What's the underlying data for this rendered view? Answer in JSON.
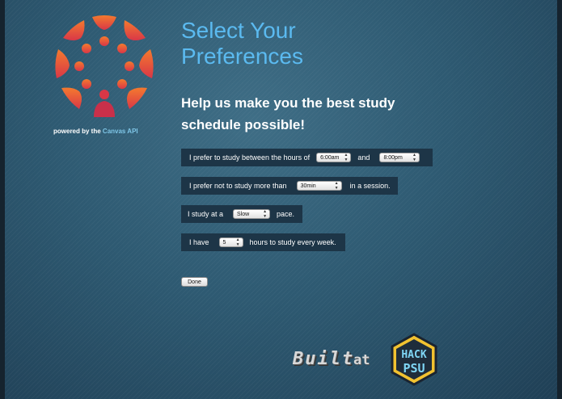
{
  "brand": {
    "powered_prefix": "powered by the",
    "powered_accent": "Canvas API",
    "logo_colors": [
      "#f26c3b",
      "#e94a3b",
      "#d93747"
    ]
  },
  "page": {
    "title_line1": "Select Your",
    "title_line2": "Preferences",
    "subtitle": "Help us make you the best study schedule possible!"
  },
  "form": {
    "hours": {
      "label_before": "I prefer to study between the hours of",
      "start": "6:00am",
      "label_mid": "and",
      "end": "8:00pm"
    },
    "session": {
      "label_before": "I prefer not to study more than",
      "value": "30min",
      "label_after": "in a session."
    },
    "pace": {
      "label_before": "I study at a",
      "value": "Slow",
      "label_after": "pace."
    },
    "weekly": {
      "label_before": "I have",
      "value": "5",
      "label_after": "hours to study every week."
    },
    "done_label": "Done"
  },
  "footer": {
    "built": "Built",
    "at": "at",
    "hack_top": "HACK",
    "hack_bottom": "PSU"
  }
}
